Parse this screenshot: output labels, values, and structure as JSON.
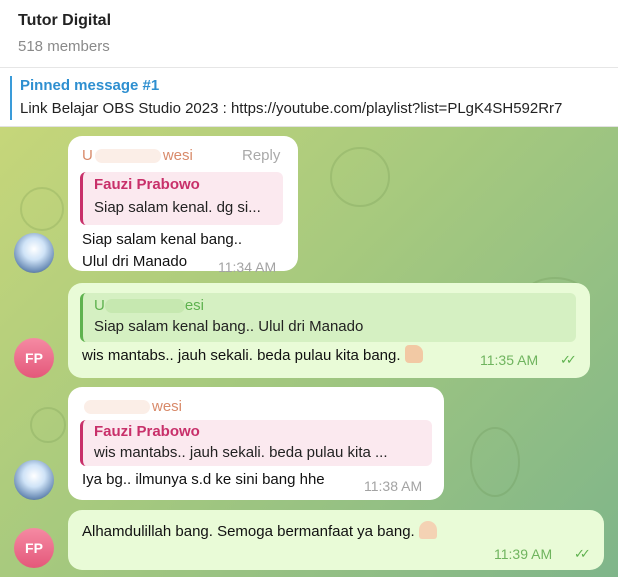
{
  "header": {
    "title": "Tutor Digital",
    "subtitle": "518 members"
  },
  "pinned": {
    "title": "Pinned message #1",
    "text": "Link Belajar OBS Studio 2023 : https://youtube.com/playlist?list=PLgK4SH592Rr7"
  },
  "reply_label": "Reply",
  "messages": [
    {
      "sender_prefix": "U",
      "sender_suffix": "wesi",
      "quote_name": "Fauzi Prabowo",
      "quote_text": "Siap salam kenal. dg si...",
      "line1": "Siap salam kenal bang..",
      "line2": "Ulul dri Manado",
      "time": "11:34 AM"
    },
    {
      "sender_prefix": "U",
      "sender_suffix": "esi",
      "quote_text": "Siap salam kenal bang.. Ulul dri Manado",
      "text": "wis mantabs.. jauh sekali. beda pulau kita bang.",
      "time": "11:35 AM",
      "avatar": "FP"
    },
    {
      "sender_suffix": "wesi",
      "quote_name": "Fauzi Prabowo",
      "quote_text": "wis mantabs.. jauh sekali. beda pulau kita ...",
      "text": "Iya bg.. ilmunya s.d ke sini bang hhe",
      "time": "11:38 AM"
    },
    {
      "text": "Alhamdulillah bang. Semoga bermanfaat ya bang.",
      "time": "11:39 AM",
      "avatar": "FP"
    }
  ],
  "icons": {
    "read": "double-check-icon",
    "thumb": "thumbs-up-emoji",
    "pray": "folded-hands-emoji"
  },
  "colors": {
    "accent": "#2e8fd0",
    "quote_pink": "#c8306a",
    "quote_green": "#5fb24f",
    "outgoing": "#e9fbd7"
  }
}
